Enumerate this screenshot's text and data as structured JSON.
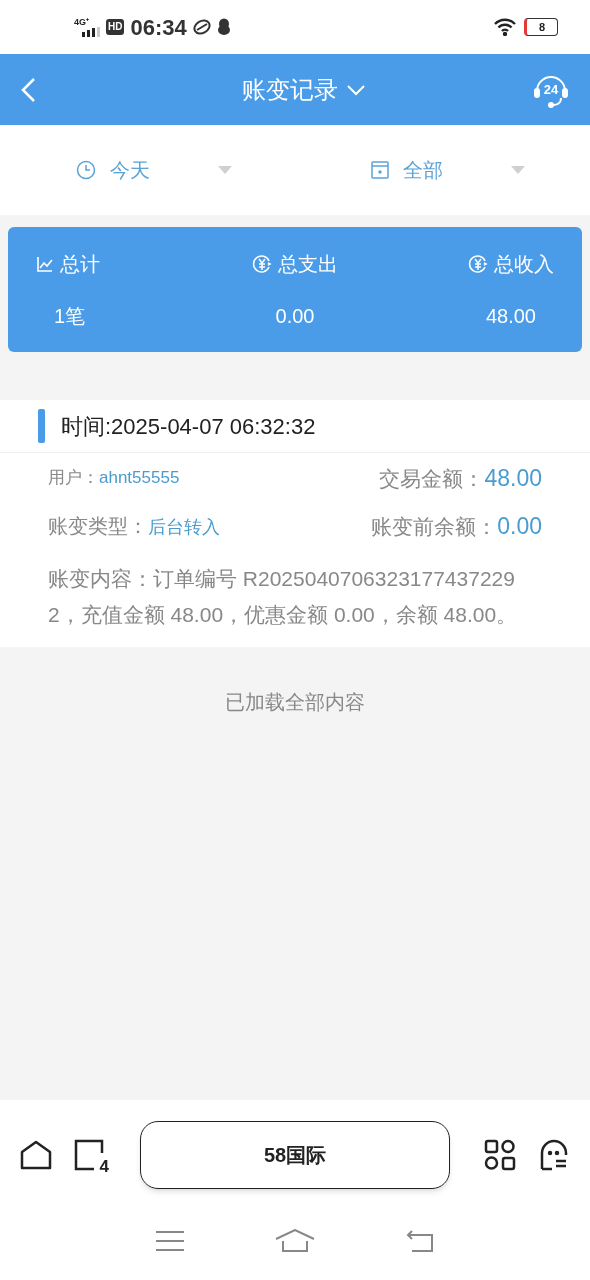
{
  "status_bar": {
    "network": "4G⁺",
    "hd": "HD",
    "time": "06:34",
    "battery": "8"
  },
  "header": {
    "title": "账变记录",
    "support_badge": "24"
  },
  "filters": [
    {
      "kind": "time",
      "label": "今天"
    },
    {
      "kind": "type",
      "label": "全部"
    }
  ],
  "summary": [
    {
      "kind": "chart",
      "label": "总计",
      "value": "1笔"
    },
    {
      "kind": "money",
      "label": "总支出",
      "value": "0.00"
    },
    {
      "kind": "money",
      "label": "总收入",
      "value": "48.00"
    }
  ],
  "record": {
    "time": "时间:2025-04-07 06:32:32",
    "user_label": "用户：",
    "user": "ahnt55555",
    "amount_label": "交易金额：",
    "amount": "48.00",
    "type_label": "账变类型：",
    "type": "后台转入",
    "before_label": "账变前余额：",
    "before": "0.00",
    "content": "账变内容：订单编号 R20250407063231774372292，充值金额 48.00，优惠金额 0.00，余额 48.00。"
  },
  "footer_note": "已加载全部内容",
  "browser_bar": {
    "tabs_count": "4",
    "address": "58国际"
  }
}
